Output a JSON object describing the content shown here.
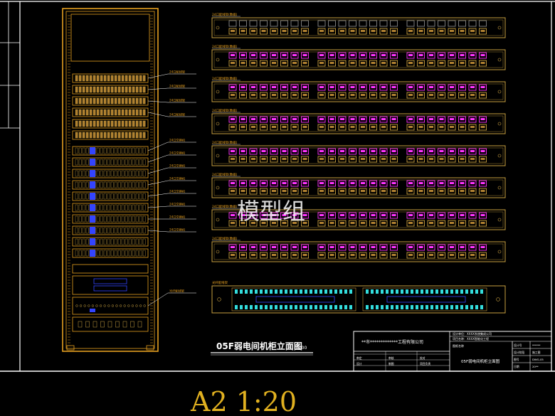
{
  "drawing": {
    "title": "05F弱电间机柜立面图",
    "scale_note": "1:100",
    "sheet_label": "A2 1:20",
    "watermark": "模型组"
  },
  "cabinet_labels": [
    "24口配线架",
    "24口配线架",
    "24口配线架",
    "24口配线架",
    "24口交换机",
    "24口交换机",
    "24口交换机",
    "24口交换机",
    "24口交换机",
    "24口交换机",
    "24口交换机",
    "24口交换机",
    "光纤配线架"
  ],
  "panel_labels": [
    "24口配线架(数据)",
    "24口配线架(数据)",
    "24口配线架(数据)",
    "24口配线架(数据)",
    "24口配线架(数据)",
    "24口配线架(数据)",
    "24口配线架(数据)",
    "24口配线架(数据)"
  ],
  "fiber_panel_label": "光纤配线架",
  "title_block": {
    "company": "**市*************工程有限公司",
    "designer_line": "设计单位：XXXX系统集成公司",
    "project_line": "项目名称：XXXX智能化工程",
    "drawing_name_label": "图纸名称",
    "drawing_name": "05F弱电间机柜立面图",
    "fields": [
      "审定",
      "审核",
      "校对",
      "设计",
      "制图",
      "项目负责"
    ],
    "meta": [
      "设计号",
      "设计阶段",
      "图号",
      "日期"
    ],
    "meta_values": [
      "******",
      "施工图",
      "DWG-05",
      "20**"
    ]
  },
  "colors": {
    "frame": "#ffffff",
    "cabinet": "#e6a020",
    "panel": "#c8a040",
    "port_magenta": "#ff33ff",
    "port_cyan": "#33dddd",
    "accent_blue": "#3344ff"
  }
}
